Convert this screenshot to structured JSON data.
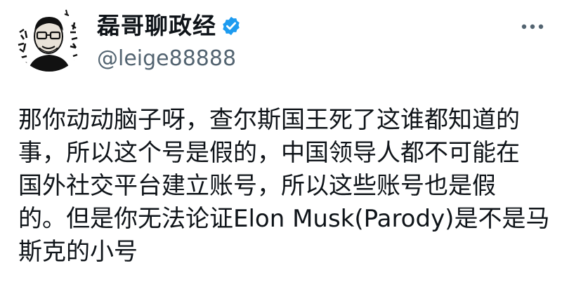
{
  "author": {
    "display_name": "磊哥聊政经",
    "handle": "@leige88888",
    "verified": true
  },
  "avatar": {
    "icon": "cartoon-man-glasses-avatar"
  },
  "tweet": {
    "lines": [
      "那你动动脑子呀，查尔斯国王死了这谁都知道的",
      "事，所以这个号是假的，中国领导人都不可能在",
      "国外社交平台建立账号，所以这些账号也是假",
      "的。但是你无法论证Elon Musk(Parody)是不是马",
      "斯克的小号"
    ]
  },
  "more_options": {
    "icon": "more-horizontal-icon"
  },
  "colors": {
    "text": "#0f1419",
    "secondary": "#536471",
    "verified": "#1d9bf0"
  }
}
